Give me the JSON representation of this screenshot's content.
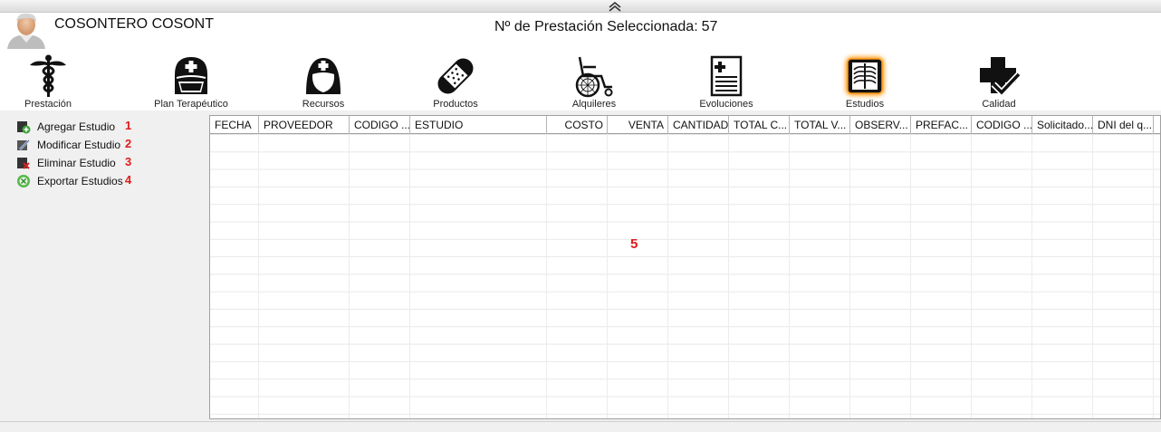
{
  "header": {
    "user_name": "COSONTERO COSONT",
    "prestacion_label": "Nº de Prestación Seleccionada:",
    "prestacion_number": "57"
  },
  "toolbar": [
    {
      "label": "Prestación",
      "icon": "caduceus-icon"
    },
    {
      "label": "Plan Terapéutico",
      "icon": "nurse-mask-icon"
    },
    {
      "label": "Recursos",
      "icon": "nurse-icon"
    },
    {
      "label": "Productos",
      "icon": "bandage-icon"
    },
    {
      "label": "Alquileres",
      "icon": "wheelchair-icon"
    },
    {
      "label": "Evoluciones",
      "icon": "medical-document-icon"
    },
    {
      "label": "Estudios",
      "icon": "xray-icon",
      "selected": true
    },
    {
      "label": "Calidad",
      "icon": "cross-check-icon"
    }
  ],
  "sidebar": {
    "items": [
      {
        "label": "Agregar Estudio",
        "number": "1",
        "icon": "add-icon"
      },
      {
        "label": "Modificar Estudio",
        "number": "2",
        "icon": "edit-icon"
      },
      {
        "label": "Eliminar Estudio",
        "number": "3",
        "icon": "delete-icon"
      },
      {
        "label": "Exportar Estudios",
        "number": "4",
        "icon": "export-icon"
      }
    ]
  },
  "grid": {
    "columns": [
      "FECHA",
      "PROVEEDOR",
      "CODIGO ...",
      "ESTUDIO",
      "COSTO",
      "VENTA",
      "CANTIDAD",
      "TOTAL C...",
      "TOTAL V...",
      "OBSERV...",
      "PREFAC...",
      "CODIGO ...",
      "Solicitado...",
      "DNI del q..."
    ],
    "rows": [],
    "marker": "5"
  },
  "colors": {
    "annotation_red": "#e01b1b",
    "selected_glow": "#ff9a1a"
  }
}
